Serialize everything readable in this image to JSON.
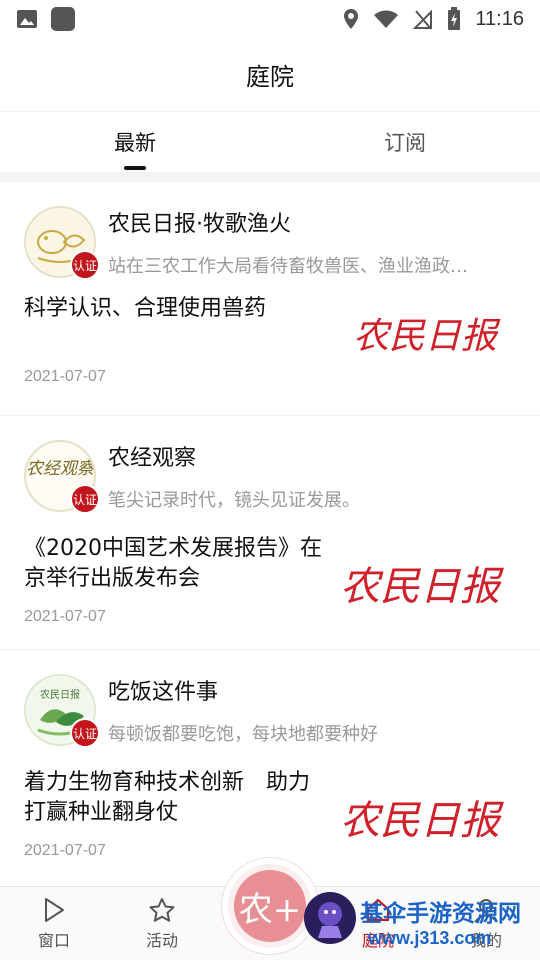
{
  "status_bar": {
    "time": "11:16"
  },
  "header": {
    "title": "庭院"
  },
  "tabs": [
    {
      "label": "最新",
      "active": true
    },
    {
      "label": "订阅",
      "active": false
    }
  ],
  "feed": [
    {
      "source": "农民日报·牧歌渔火",
      "description": "站在三农工作大局看待畜牧兽医、渔业渔政…",
      "headline": "科学认识、合理使用兽药",
      "date": "2021-07-07",
      "badge": "认证",
      "thumbnail_text": "农民日报"
    },
    {
      "source": "农经观察",
      "description": "笔尖记录时代，镜头见证发展。",
      "headline": "《2020中国艺术发展报告》在京举行出版发布会",
      "date": "2021-07-07",
      "badge": "认证",
      "thumbnail_text": "农民日报"
    },
    {
      "source": "吃饭这件事",
      "description": "每顿饭都要吃饱，每块地都要种好",
      "headline": "着力生物育种技术创新　助力打赢种业翻身仗",
      "date": "2021-07-07",
      "badge": "认证",
      "thumbnail_text": "农民日报"
    }
  ],
  "avatar_text": {
    "feed2": "农经观察",
    "feed3": "农民日报"
  },
  "bottom_nav": [
    {
      "label": "窗口",
      "icon": "play-icon"
    },
    {
      "label": "活动",
      "icon": "star-icon"
    },
    {
      "label": "庭院",
      "icon": "courtyard-icon",
      "active": true
    },
    {
      "label": "我的",
      "icon": "user-icon"
    }
  ],
  "fab": {
    "label": "农+"
  },
  "watermark": {
    "line1": "基伞手游资源网",
    "line2": "www.j313.com"
  },
  "colors": {
    "accent": "#c3161c",
    "watermark": "#1b63c6"
  }
}
